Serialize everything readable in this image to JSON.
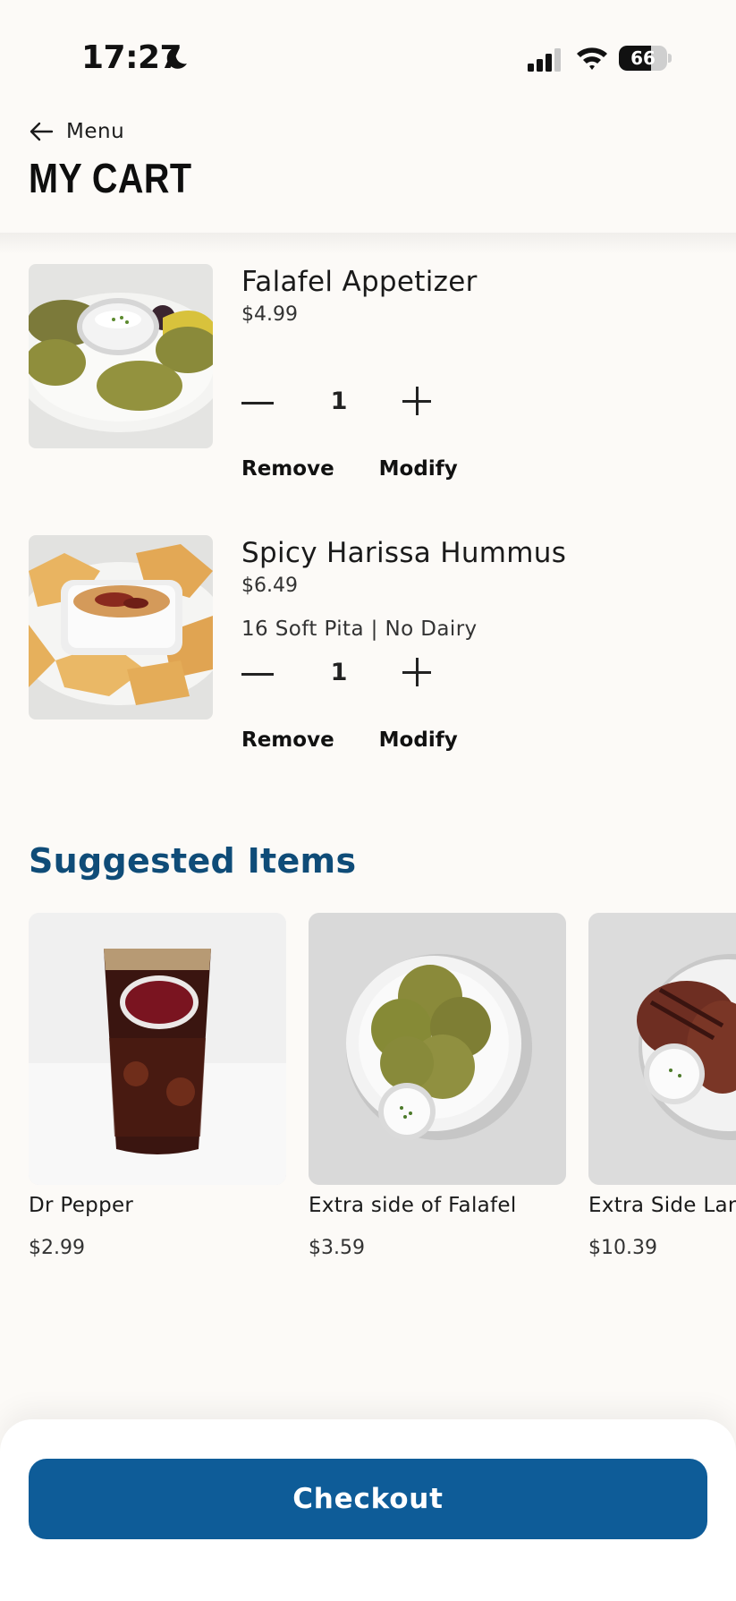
{
  "status_bar": {
    "time": "17:27",
    "battery_level": "66",
    "battery_fraction": 0.66
  },
  "header": {
    "back_label": "Menu",
    "title": "MY CART"
  },
  "cart": {
    "items": [
      {
        "name": "Falafel Appetizer",
        "price": "$4.99",
        "modifiers": "",
        "quantity": "1",
        "remove_label": "Remove",
        "modify_label": "Modify"
      },
      {
        "name": "Spicy Harissa Hummus",
        "price": "$6.49",
        "modifiers": "16 Soft Pita | No Dairy",
        "quantity": "1",
        "remove_label": "Remove",
        "modify_label": "Modify"
      }
    ]
  },
  "suggested": {
    "title": "Suggested Items",
    "items": [
      {
        "name": "Dr Pepper",
        "price": "$2.99"
      },
      {
        "name": "Extra side of Falafel",
        "price": "$3.59"
      },
      {
        "name": "Extra Side Lar",
        "price": "$10.39"
      }
    ]
  },
  "checkout": {
    "label": "Checkout"
  },
  "colors": {
    "brand_blue": "#0e5c98",
    "heading_blue": "#0f4c78",
    "background": "#fcfaf7"
  }
}
